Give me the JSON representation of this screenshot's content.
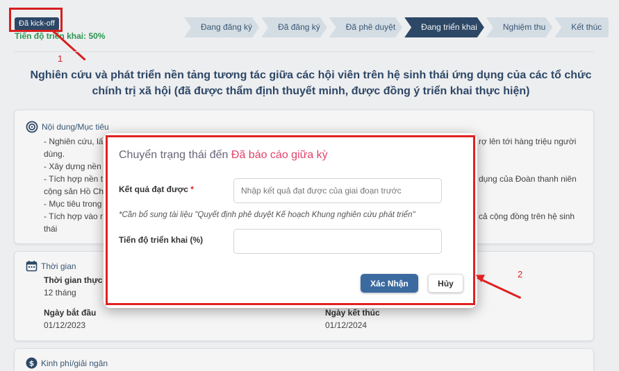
{
  "status": {
    "badge": "Đã kick-off",
    "progress": "Tiến độ triển khai: 50%"
  },
  "stepper": [
    "Đang đăng ký",
    "Đã đăng ký",
    "Đã phê duyệt",
    "Đang triển khai",
    "Nghiệm thu",
    "Kết thúc"
  ],
  "title_line1": "Nghiên cứu và phát triển nền tảng tương tác giữa các hội viên trên hệ sinh thái ứng dụng của các tổ chức",
  "title_line2": "chính trị xã hội (đã được thẩm định thuyết minh, được đồng ý triển khai thực hiện)",
  "content": {
    "heading": "Nội dung/Mục tiêu",
    "left_lines": [
      "- Nghiên cứu, lấ",
      "dùng.",
      "- Xây dựng nền",
      "- Tích hợp nền t",
      "cộng sản Hồ Ch",
      "- Mục tiêu trong",
      "- Tích hợp vào r",
      "thái"
    ],
    "right_lines": [
      "rợ lên tới hàng triệu người",
      "dụng của Đoàn thanh niên",
      "cả cộng đồng trên hệ sinh"
    ]
  },
  "time": {
    "heading": "Thời gian",
    "duration_label": "Thời gian thực h",
    "duration_value": "12 tháng",
    "start_label": "Ngày bắt đầu",
    "start_value": "01/12/2023",
    "end_label": "Ngày kết thúc",
    "end_value": "01/12/2024"
  },
  "budget": {
    "heading": "Kinh phí/giải ngân"
  },
  "modal": {
    "title_prefix": "Chuyển trạng thái đến ",
    "title_highlight": "Đã báo cáo giữa kỳ",
    "result_label": "Kết quả đạt được",
    "required_mark": "*",
    "result_placeholder": "Nhập kết quả đạt được của giai đoạn trước",
    "note": "*Cần bổ sung tài liệu \"Quyết định phê duyệt Kế hoạch Khung nghiên cứu phát triển\"",
    "progress_label": "Tiến độ triển khai (%)",
    "progress_value": "",
    "confirm": "Xác Nhận",
    "cancel": "Hủy"
  },
  "annotations": {
    "one": "1",
    "two": "2"
  },
  "colors": {
    "primary": "#2f4a6b",
    "accent": "#e0436a",
    "annotation": "#e02020",
    "progress": "#2e9c55"
  },
  "icons": {
    "content": "target-icon",
    "time": "calendar-icon",
    "budget": "dollar-icon"
  }
}
